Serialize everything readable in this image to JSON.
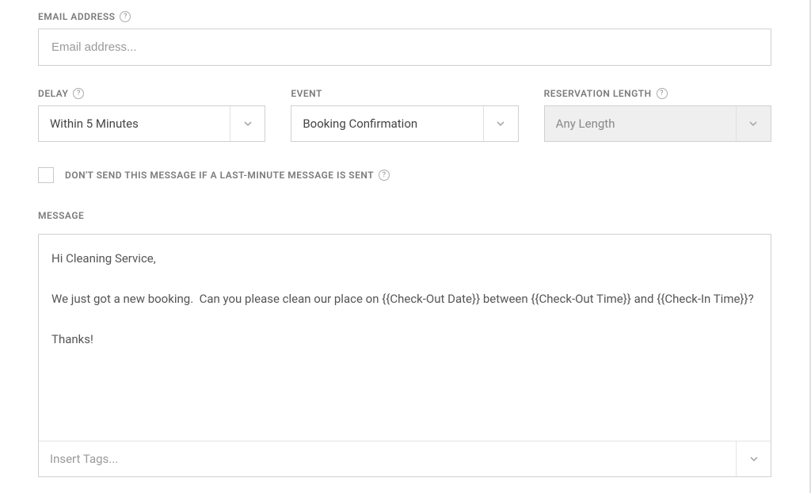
{
  "email": {
    "label": "EMAIL ADDRESS",
    "placeholder": "Email address..."
  },
  "delay": {
    "label": "DELAY",
    "value": "Within 5 Minutes"
  },
  "event": {
    "label": "EVENT",
    "value": "Booking Confirmation"
  },
  "reservationLength": {
    "label": "RESERVATION LENGTH",
    "value": "Any Length"
  },
  "lastMinute": {
    "label": "DON'T SEND THIS MESSAGE IF A LAST-MINUTE MESSAGE IS SENT"
  },
  "message": {
    "label": "MESSAGE",
    "content": "Hi Cleaning Service,\n\nWe just got a new booking.  Can you please clean our place on {{Check-Out Date}} between {{Check-Out Time}} and {{Check-In Time}}?\n\nThanks!"
  },
  "tags": {
    "placeholder": "Insert Tags..."
  }
}
